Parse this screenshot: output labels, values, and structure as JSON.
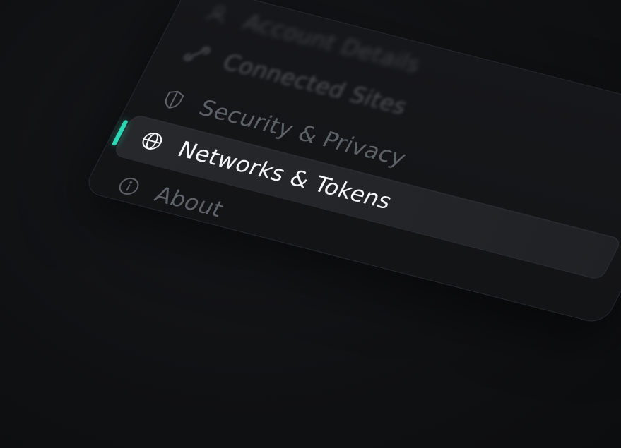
{
  "settings_menu": {
    "items": [
      {
        "id": "dashboard",
        "label": "Account Details",
        "icon": "person-icon",
        "state": "blurred"
      },
      {
        "id": "connected-sites",
        "label": "Connected Sites",
        "icon": "link-icon",
        "state": "blurred"
      },
      {
        "id": "security",
        "label": "Security & Privacy",
        "icon": "shield-icon",
        "state": "inactive"
      },
      {
        "id": "networks",
        "label": "Networks & Tokens",
        "icon": "globe-icon",
        "state": "active"
      },
      {
        "id": "about",
        "label": "About",
        "icon": "info-icon",
        "state": "inactive"
      }
    ],
    "active_index": 3
  },
  "colors": {
    "background": "#0f1012",
    "panel": "#151618",
    "active_row": "#242629",
    "accent": "#2fd6b5",
    "active_text": "#f4f5f7",
    "inactive_text": "#5d6168"
  }
}
